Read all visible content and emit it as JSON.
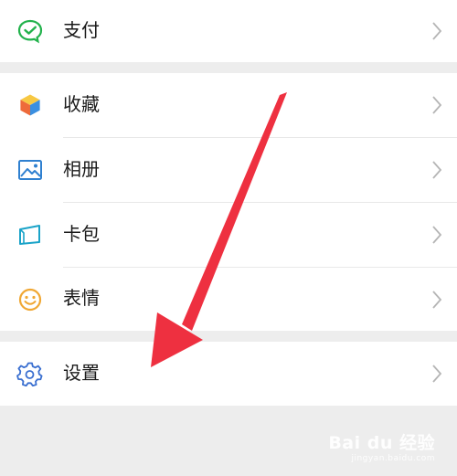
{
  "menu": {
    "pay": {
      "label": "支付",
      "icon": "wechat-pay-icon"
    },
    "favorites": {
      "label": "收藏",
      "icon": "cube-icon"
    },
    "album": {
      "label": "相册",
      "icon": "image-icon"
    },
    "cards": {
      "label": "卡包",
      "icon": "card-icon"
    },
    "stickers": {
      "label": "表情",
      "icon": "smile-icon"
    },
    "settings": {
      "label": "设置",
      "icon": "gear-icon"
    }
  },
  "colors": {
    "background": "#ededed",
    "row": "#ffffff",
    "pay_green": "#22b24c",
    "album_blue": "#2f80d0",
    "card_teal": "#1aa3c8",
    "smile_orange": "#f0a733",
    "gear_blue": "#3a6fd0",
    "arrow_red": "#ee3040"
  },
  "watermark": {
    "logo_text": "Bai du 经验",
    "sub_text": "jingyan.baidu.com"
  }
}
